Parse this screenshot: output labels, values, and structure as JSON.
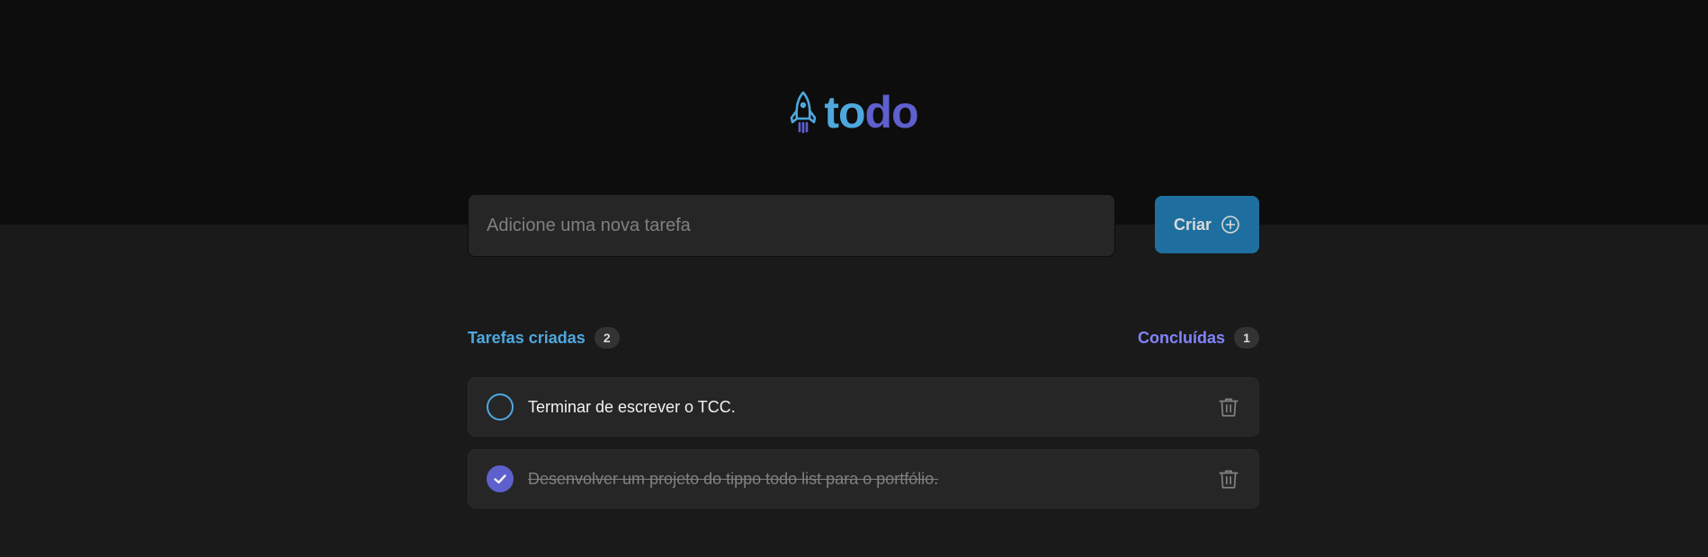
{
  "logo": {
    "text_to": "to",
    "text_do": "do",
    "icon": "rocket-icon"
  },
  "new_task": {
    "placeholder": "Adicione uma nova tarefa",
    "value": ""
  },
  "create_button": {
    "label": "Criar",
    "icon": "plus-circle-icon"
  },
  "summary": {
    "created_label": "Tarefas criadas",
    "created_count": "2",
    "completed_label": "Concluídas",
    "completed_count": "1"
  },
  "tasks": [
    {
      "text": "Terminar de escrever o TCC.",
      "completed": false
    },
    {
      "text": "Desenvolver um projeto do tippo todo list para o portfólio.",
      "completed": true
    }
  ],
  "colors": {
    "brand_blue": "#4ea8de",
    "brand_purple": "#5e60ce",
    "button_blue": "#1e6f9f",
    "completed_label": "#8284fa",
    "header_bg": "#0d0d0d",
    "body_bg": "#1a1a1a"
  }
}
